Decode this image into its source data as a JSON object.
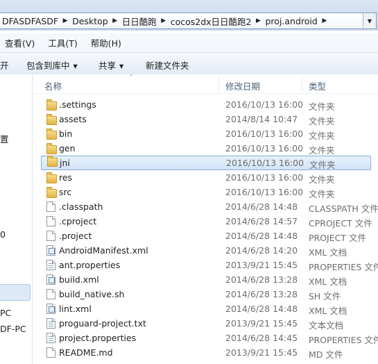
{
  "address": {
    "crumbs": [
      "DFASDFASDF",
      "Desktop",
      "日日酷跑",
      "cocos2dx日日酷跑2",
      "proj.android"
    ]
  },
  "menu": {
    "view": "查看(V)",
    "tools": "工具(T)",
    "help": "帮助(H)"
  },
  "toolbar": {
    "open": "开",
    "include_library": "包含到库中",
    "share": "共享",
    "new_folder": "新建文件夹"
  },
  "nav": {
    "item1": "置",
    "item2": "0",
    "item3": "PC",
    "item4": "DF-PC"
  },
  "columns": {
    "name": "名称",
    "date": "修改日期",
    "type": "类型"
  },
  "files": [
    {
      "name": ".settings",
      "date": "2016/10/13 16:00",
      "type": "文件夹",
      "icon": "folder-icon"
    },
    {
      "name": "assets",
      "date": "2014/8/14 10:47",
      "type": "文件夹",
      "icon": "folder-icon"
    },
    {
      "name": "bin",
      "date": "2016/10/13 16:00",
      "type": "文件夹",
      "icon": "folder-icon"
    },
    {
      "name": "gen",
      "date": "2016/10/13 16:00",
      "type": "文件夹",
      "icon": "folder-icon"
    },
    {
      "name": "jni",
      "date": "2016/10/13 16:00",
      "type": "文件夹",
      "icon": "folder-icon"
    },
    {
      "name": "res",
      "date": "2016/10/13 16:00",
      "type": "文件夹",
      "icon": "folder-icon"
    },
    {
      "name": "src",
      "date": "2016/10/13 16:00",
      "type": "文件夹",
      "icon": "folder-icon"
    },
    {
      "name": ".classpath",
      "date": "2014/6/28 14:48",
      "type": "CLASSPATH 文件",
      "icon": "file-icon"
    },
    {
      "name": ".cproject",
      "date": "2014/6/28 14:57",
      "type": "CPROJECT 文件",
      "icon": "file-icon"
    },
    {
      "name": ".project",
      "date": "2014/6/28 14:48",
      "type": "PROJECT 文件",
      "icon": "file-icon"
    },
    {
      "name": "AndroidManifest.xml",
      "date": "2014/6/28 14:20",
      "type": "XML 文档",
      "icon": "xml-file-icon"
    },
    {
      "name": "ant.properties",
      "date": "2013/9/21 15:45",
      "type": "PROPERTIES 文件",
      "icon": "text-file-icon"
    },
    {
      "name": "build.xml",
      "date": "2014/6/28 13:28",
      "type": "XML 文档",
      "icon": "xml-file-icon"
    },
    {
      "name": "build_native.sh",
      "date": "2014/6/28 13:28",
      "type": "SH 文件",
      "icon": "file-icon"
    },
    {
      "name": "lint.xml",
      "date": "2014/6/28 14:48",
      "type": "XML 文档",
      "icon": "xml-file-icon"
    },
    {
      "name": "proguard-project.txt",
      "date": "2013/9/21 15:45",
      "type": "文本文档",
      "icon": "text-file-icon"
    },
    {
      "name": "project.properties",
      "date": "2014/6/28 14:45",
      "type": "PROPERTIES 文件",
      "icon": "text-file-icon"
    },
    {
      "name": "README.md",
      "date": "2013/9/21 15:45",
      "type": "MD 文件",
      "icon": "file-icon"
    }
  ],
  "selected_row": "jni",
  "colors": {
    "selection_bg": "#d2e4f8",
    "selection_border": "#84acdd",
    "folder": "#e2b544"
  }
}
